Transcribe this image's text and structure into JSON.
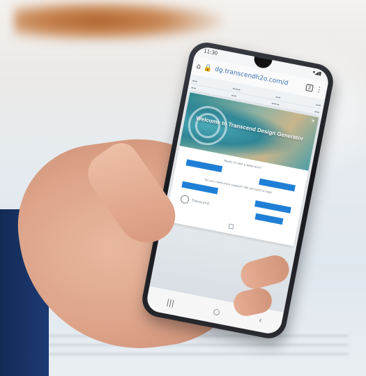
{
  "status": {
    "time": "11:30"
  },
  "browser": {
    "url": "dg.transcendh2o.com/d",
    "tab_count": "3"
  },
  "modal": {
    "title": "Welcome to Transcend Design Generator",
    "question_1": "Ready to take a deep dive?",
    "question_2": "Do you need more support? We are here to help!",
    "brand": "Transcend"
  },
  "icons": {
    "home": "home-icon",
    "lock": "lock-icon",
    "menu": "kebab-menu-icon",
    "close": "close-icon",
    "recents": "recents-icon",
    "nav_home": "nav-home-icon",
    "back": "back-icon"
  },
  "colors": {
    "button_blue": "#1f7fd6",
    "banner_teal": "#2f8696",
    "sleeve_navy": "#1d3b73"
  }
}
